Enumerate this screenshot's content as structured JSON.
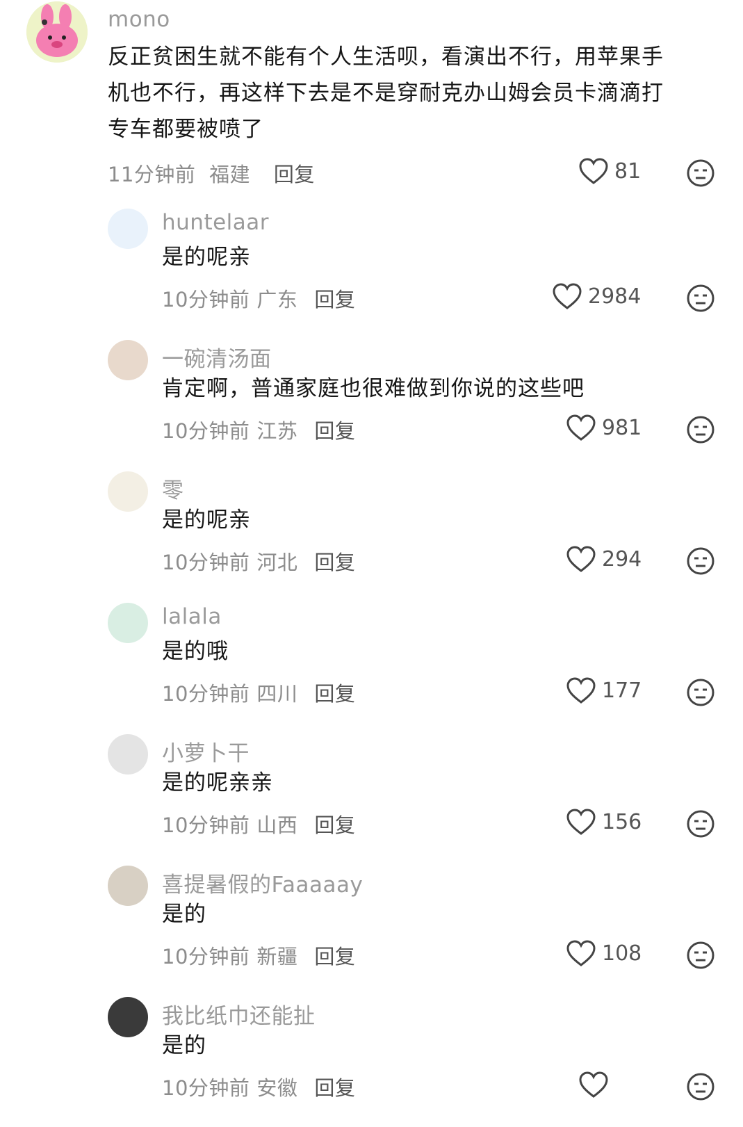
{
  "comments": [
    {
      "username": "mono",
      "lines": [
        "反正贫困生就不能有个人生活呗，看演出不行，用苹果手",
        "机也不行，再这样下去是不是穿耐克办山姆会员卡滴滴打",
        "专车都要被喷了"
      ],
      "time": "11分钟前",
      "location": "福建",
      "reply_label": "回复",
      "likes": "81"
    }
  ],
  "replies": [
    {
      "username": "huntelaar",
      "text": "是的呢亲",
      "time": "10分钟前",
      "location": "广东",
      "reply_label": "回复",
      "likes": "2984"
    },
    {
      "username": "一碗清汤面",
      "text": "肯定啊，普通家庭也很难做到你说的这些吧",
      "time": "10分钟前",
      "location": "江苏",
      "reply_label": "回复",
      "likes": "981"
    },
    {
      "username": "零",
      "text": "是的呢亲",
      "time": "10分钟前",
      "location": "河北",
      "reply_label": "回复",
      "likes": "294"
    },
    {
      "username": "lalala",
      "text": "是的哦",
      "time": "10分钟前",
      "location": "四川",
      "reply_label": "回复",
      "likes": "177"
    },
    {
      "username": "小萝卜干",
      "text": "是的呢亲亲",
      "time": "10分钟前",
      "location": "山西",
      "reply_label": "回复",
      "likes": "156"
    },
    {
      "username": "喜提暑假的Faaaaay",
      "text": "是的",
      "time": "10分钟前",
      "location": "新疆",
      "reply_label": "回复",
      "likes": "108"
    },
    {
      "username": "我比纸巾还能扯",
      "text": "是的",
      "time": "10分钟前",
      "location": "安徽",
      "reply_label": "回复",
      "likes": ""
    }
  ]
}
